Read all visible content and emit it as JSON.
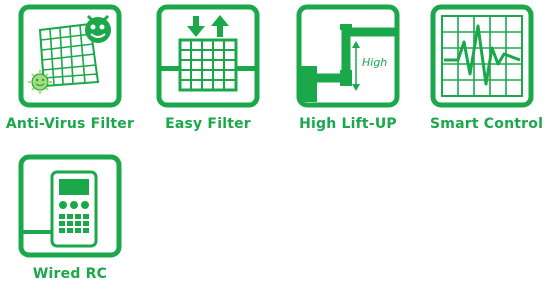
{
  "colors": {
    "brand_green": "#1aa84a",
    "light_green": "#a8dc7a"
  },
  "features": [
    {
      "label": "Anti-Virus Filter",
      "icon": "anti-virus-filter-icon"
    },
    {
      "label": "Easy Filter",
      "icon": "easy-filter-icon"
    },
    {
      "label": "High Lift-UP",
      "icon": "high-lift-up-icon",
      "icon_text": "High"
    },
    {
      "label": "Smart Control",
      "icon": "smart-control-icon"
    },
    {
      "label": "Wired RC",
      "icon": "wired-rc-icon"
    }
  ]
}
